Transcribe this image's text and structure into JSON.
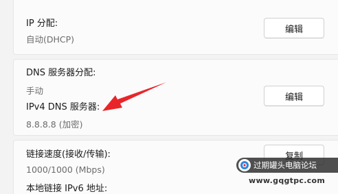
{
  "ip_section": {
    "label": "IP 分配:",
    "value": "自动(DHCP)",
    "edit_button": "编辑"
  },
  "dns_section": {
    "label": "DNS 服务器分配:",
    "value": "手动",
    "ipv4_label": "IPv4 DNS 服务器:",
    "ipv4_value": "8.8.8.8 (加密)",
    "edit_button": "编辑"
  },
  "link_section": {
    "speed_label": "链接速度(接收/传输):",
    "speed_value": "1000/1000 (Mbps)",
    "ipv6_label": "本地链接 IPv6 地址:",
    "copy_button": "复制"
  },
  "annotation": {
    "arrow_color": "#e8262a"
  },
  "watermark": {
    "title": "过期罐头电脑论坛",
    "url": "www.gqgtpc.com"
  }
}
